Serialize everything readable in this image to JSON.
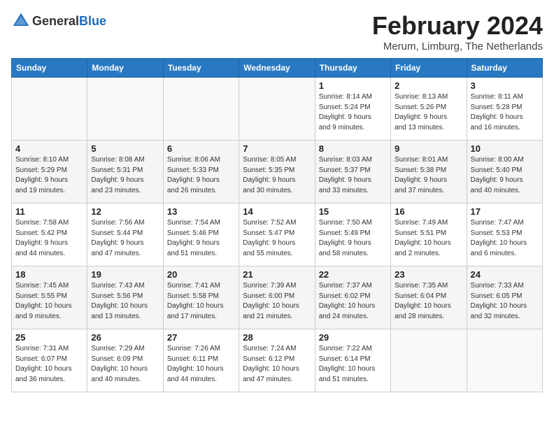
{
  "header": {
    "logo_general": "General",
    "logo_blue": "Blue",
    "month_year": "February 2024",
    "location": "Merum, Limburg, The Netherlands"
  },
  "weekdays": [
    "Sunday",
    "Monday",
    "Tuesday",
    "Wednesday",
    "Thursday",
    "Friday",
    "Saturday"
  ],
  "weeks": [
    [
      {
        "day": "",
        "info": ""
      },
      {
        "day": "",
        "info": ""
      },
      {
        "day": "",
        "info": ""
      },
      {
        "day": "",
        "info": ""
      },
      {
        "day": "1",
        "info": "Sunrise: 8:14 AM\nSunset: 5:24 PM\nDaylight: 9 hours\nand 9 minutes."
      },
      {
        "day": "2",
        "info": "Sunrise: 8:13 AM\nSunset: 5:26 PM\nDaylight: 9 hours\nand 13 minutes."
      },
      {
        "day": "3",
        "info": "Sunrise: 8:11 AM\nSunset: 5:28 PM\nDaylight: 9 hours\nand 16 minutes."
      }
    ],
    [
      {
        "day": "4",
        "info": "Sunrise: 8:10 AM\nSunset: 5:29 PM\nDaylight: 9 hours\nand 19 minutes."
      },
      {
        "day": "5",
        "info": "Sunrise: 8:08 AM\nSunset: 5:31 PM\nDaylight: 9 hours\nand 23 minutes."
      },
      {
        "day": "6",
        "info": "Sunrise: 8:06 AM\nSunset: 5:33 PM\nDaylight: 9 hours\nand 26 minutes."
      },
      {
        "day": "7",
        "info": "Sunrise: 8:05 AM\nSunset: 5:35 PM\nDaylight: 9 hours\nand 30 minutes."
      },
      {
        "day": "8",
        "info": "Sunrise: 8:03 AM\nSunset: 5:37 PM\nDaylight: 9 hours\nand 33 minutes."
      },
      {
        "day": "9",
        "info": "Sunrise: 8:01 AM\nSunset: 5:38 PM\nDaylight: 9 hours\nand 37 minutes."
      },
      {
        "day": "10",
        "info": "Sunrise: 8:00 AM\nSunset: 5:40 PM\nDaylight: 9 hours\nand 40 minutes."
      }
    ],
    [
      {
        "day": "11",
        "info": "Sunrise: 7:58 AM\nSunset: 5:42 PM\nDaylight: 9 hours\nand 44 minutes."
      },
      {
        "day": "12",
        "info": "Sunrise: 7:56 AM\nSunset: 5:44 PM\nDaylight: 9 hours\nand 47 minutes."
      },
      {
        "day": "13",
        "info": "Sunrise: 7:54 AM\nSunset: 5:46 PM\nDaylight: 9 hours\nand 51 minutes."
      },
      {
        "day": "14",
        "info": "Sunrise: 7:52 AM\nSunset: 5:47 PM\nDaylight: 9 hours\nand 55 minutes."
      },
      {
        "day": "15",
        "info": "Sunrise: 7:50 AM\nSunset: 5:49 PM\nDaylight: 9 hours\nand 58 minutes."
      },
      {
        "day": "16",
        "info": "Sunrise: 7:49 AM\nSunset: 5:51 PM\nDaylight: 10 hours\nand 2 minutes."
      },
      {
        "day": "17",
        "info": "Sunrise: 7:47 AM\nSunset: 5:53 PM\nDaylight: 10 hours\nand 6 minutes."
      }
    ],
    [
      {
        "day": "18",
        "info": "Sunrise: 7:45 AM\nSunset: 5:55 PM\nDaylight: 10 hours\nand 9 minutes."
      },
      {
        "day": "19",
        "info": "Sunrise: 7:43 AM\nSunset: 5:56 PM\nDaylight: 10 hours\nand 13 minutes."
      },
      {
        "day": "20",
        "info": "Sunrise: 7:41 AM\nSunset: 5:58 PM\nDaylight: 10 hours\nand 17 minutes."
      },
      {
        "day": "21",
        "info": "Sunrise: 7:39 AM\nSunset: 6:00 PM\nDaylight: 10 hours\nand 21 minutes."
      },
      {
        "day": "22",
        "info": "Sunrise: 7:37 AM\nSunset: 6:02 PM\nDaylight: 10 hours\nand 24 minutes."
      },
      {
        "day": "23",
        "info": "Sunrise: 7:35 AM\nSunset: 6:04 PM\nDaylight: 10 hours\nand 28 minutes."
      },
      {
        "day": "24",
        "info": "Sunrise: 7:33 AM\nSunset: 6:05 PM\nDaylight: 10 hours\nand 32 minutes."
      }
    ],
    [
      {
        "day": "25",
        "info": "Sunrise: 7:31 AM\nSunset: 6:07 PM\nDaylight: 10 hours\nand 36 minutes."
      },
      {
        "day": "26",
        "info": "Sunrise: 7:29 AM\nSunset: 6:09 PM\nDaylight: 10 hours\nand 40 minutes."
      },
      {
        "day": "27",
        "info": "Sunrise: 7:26 AM\nSunset: 6:11 PM\nDaylight: 10 hours\nand 44 minutes."
      },
      {
        "day": "28",
        "info": "Sunrise: 7:24 AM\nSunset: 6:12 PM\nDaylight: 10 hours\nand 47 minutes."
      },
      {
        "day": "29",
        "info": "Sunrise: 7:22 AM\nSunset: 6:14 PM\nDaylight: 10 hours\nand 51 minutes."
      },
      {
        "day": "",
        "info": ""
      },
      {
        "day": "",
        "info": ""
      }
    ]
  ]
}
